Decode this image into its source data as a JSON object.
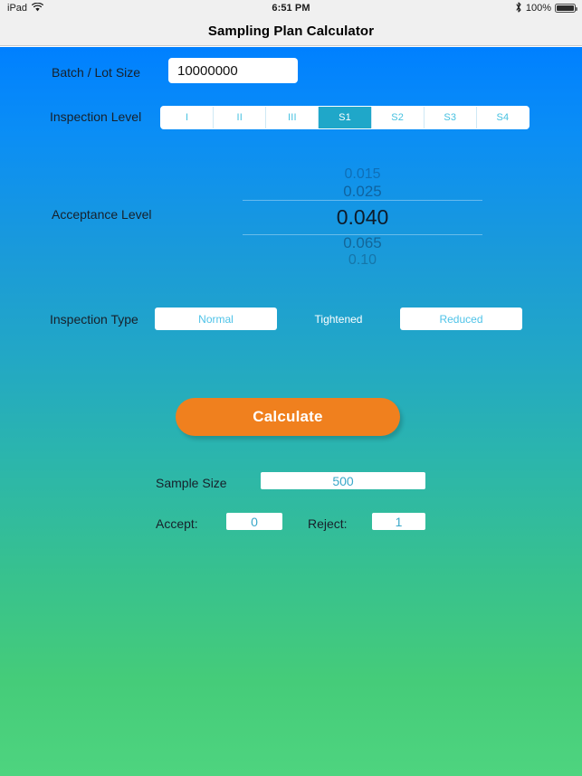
{
  "status_bar": {
    "device": "iPad",
    "wifi_icon": "wifi-icon",
    "time": "6:51 PM",
    "bluetooth_icon": "bluetooth-icon",
    "battery_percent": "100%",
    "battery_icon": "battery-full-icon"
  },
  "nav": {
    "title": "Sampling Plan Calculator"
  },
  "form": {
    "batch_label": "Batch / Lot Size",
    "batch_value": "10000000",
    "batch_placeholder": "Batch / Lot Size",
    "inspection_level_label": "Inspection Level",
    "inspection_levels": [
      {
        "label": "I",
        "selected": false
      },
      {
        "label": "II",
        "selected": false
      },
      {
        "label": "III",
        "selected": false
      },
      {
        "label": "S1",
        "selected": true
      },
      {
        "label": "S2",
        "selected": false
      },
      {
        "label": "S3",
        "selected": false
      },
      {
        "label": "S4",
        "selected": false
      }
    ],
    "acceptance_label": "Acceptance Level",
    "acceptance_options": [
      "0.015",
      "0.025",
      "0.040",
      "0.065",
      "0.10"
    ],
    "acceptance_selected": "0.040",
    "inspection_type_label": "Inspection Type",
    "inspection_types": [
      {
        "label": "Normal",
        "style": "boxed"
      },
      {
        "label": "Tightened",
        "style": "plain"
      },
      {
        "label": "Reduced",
        "style": "boxed"
      }
    ]
  },
  "actions": {
    "calculate_label": "Calculate"
  },
  "results": {
    "sample_size_label": "Sample Size",
    "sample_size_value": "500",
    "accept_label": "Accept:",
    "accept_value": "0",
    "reject_label": "Reject:",
    "reject_value": "1"
  },
  "colors": {
    "gradient_top": "#0080ff",
    "gradient_bottom": "#4ed47f",
    "accent_selected": "#1fa7c9",
    "segment_text": "#46c1e0",
    "calculate_button": "#f0801e",
    "navbar_background": "#f0f0f0"
  }
}
